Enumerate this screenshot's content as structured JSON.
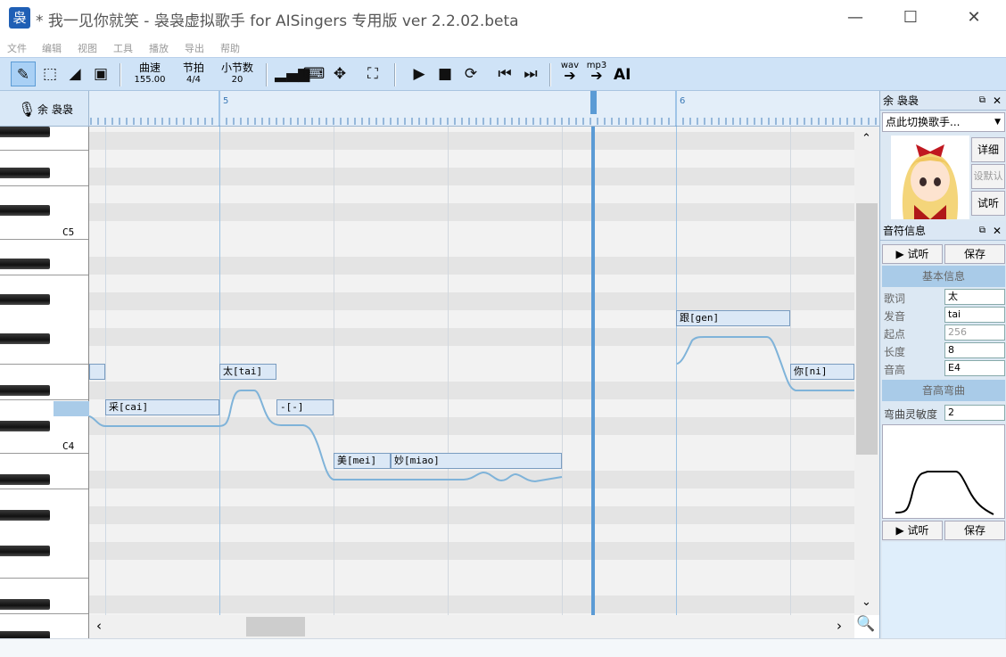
{
  "window": {
    "title": "* 我一见你就笑 - 袅袅虚拟歌手 for AISingers 专用版 ver 2.2.02.beta",
    "minimize": "—",
    "maximize": "☐",
    "close": "✕"
  },
  "menu": [
    "文件",
    "编辑",
    "视图",
    "工具",
    "播放",
    "导出",
    "帮助"
  ],
  "toolbar": {
    "tempo_label": "曲速",
    "tempo_value": "155.00",
    "beat_label": "节拍",
    "beat_value": "4/4",
    "bars_label": "小节数",
    "bars_value": "20",
    "wav_label": "wav",
    "mp3_label": "mp3",
    "ai_label": "AI"
  },
  "track": {
    "name": "余 袅袅"
  },
  "ruler": {
    "markers": [
      "5",
      "6"
    ]
  },
  "piano": {
    "labels": [
      "C5",
      "C4"
    ]
  },
  "notes": [
    {
      "lyric": "采[cai]"
    },
    {
      "lyric": "太[tai]"
    },
    {
      "lyric": "-[-]"
    },
    {
      "lyric": "美[mei]"
    },
    {
      "lyric": "妙[miao]"
    },
    {
      "lyric": "跟[gen]"
    },
    {
      "lyric": "你[ni]"
    }
  ],
  "singer_panel": {
    "title": "余 袅袅",
    "switch_label": "点此切换歌手...",
    "detail_btn": "详细",
    "default_btn": "设默认",
    "listen_btn": "试听"
  },
  "note_panel": {
    "title": "音符信息",
    "listen_btn": "▶ 试听",
    "save_btn": "保存",
    "basic_section": "基本信息",
    "fields": [
      {
        "label": "歌词",
        "value": "太"
      },
      {
        "label": "发音",
        "value": "tai"
      },
      {
        "label": "起点",
        "value": "256"
      },
      {
        "label": "长度",
        "value": "8"
      },
      {
        "label": "音高",
        "value": "E4"
      }
    ],
    "bend_section": "音高弯曲",
    "bend_label": "弯曲灵敏度",
    "bend_value": "2",
    "listen_btn2": "▶ 试听",
    "save_btn2": "保存"
  },
  "colors": {
    "accent": "#5b9bd5",
    "toolbar": "#cfe3f7",
    "note_fill": "#dbe8f6",
    "pitch_line": "#7fb3d9"
  }
}
